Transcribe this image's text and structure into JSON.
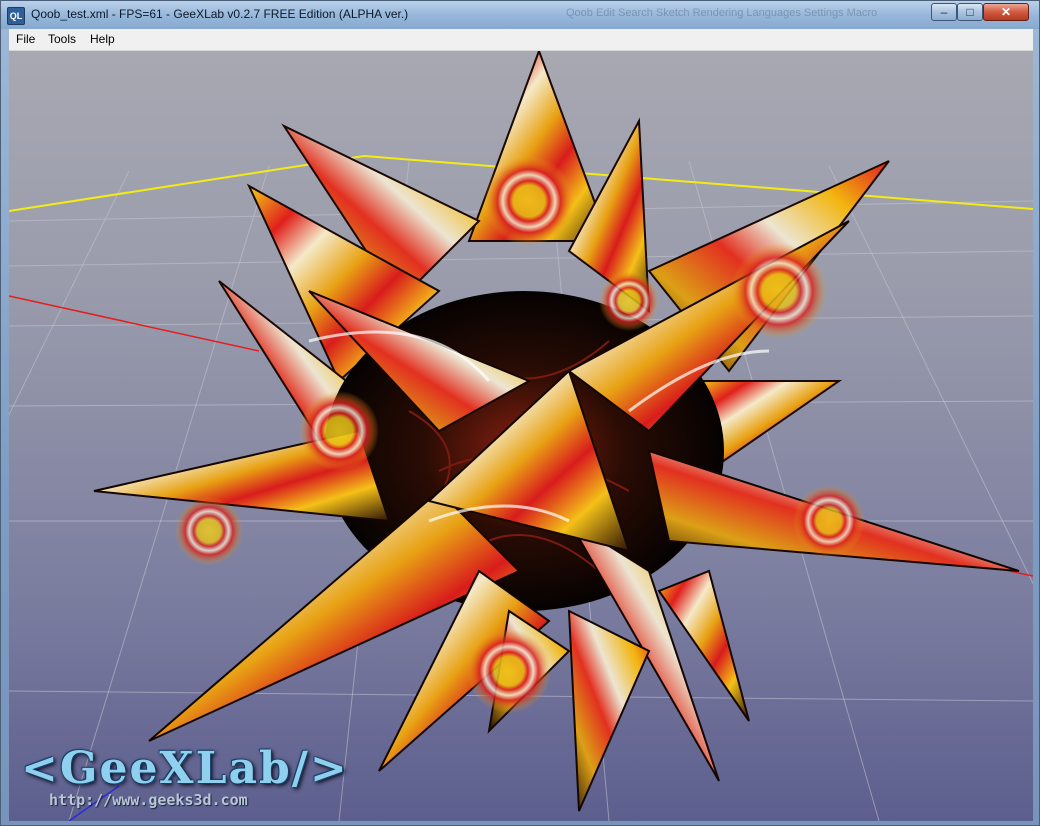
{
  "window": {
    "title": "Qoob_test.xml - FPS=61 - GeeXLab v0.2.7 FREE Edition (ALPHA ver.)",
    "app_icon_text": "QL",
    "background_title_text": "Qoob   Edit   Search   Sketch   Rendering   Languages   Settings   Macro"
  },
  "controls": {
    "minimize": "–",
    "maximize": "□",
    "close": "✕"
  },
  "menu": {
    "items": [
      {
        "label": "File"
      },
      {
        "label": "Tools"
      },
      {
        "label": "Help"
      }
    ]
  },
  "overlay": {
    "logo": "<GeeXLab/>",
    "url": "http://www.geeks3d.com"
  },
  "colors": {
    "grid_ring": "#f2ec14",
    "axis_x": "#e51d1d",
    "axis_z": "#2c2cd8",
    "object_red": "#dc2626",
    "object_yellow": "#e8b412"
  }
}
